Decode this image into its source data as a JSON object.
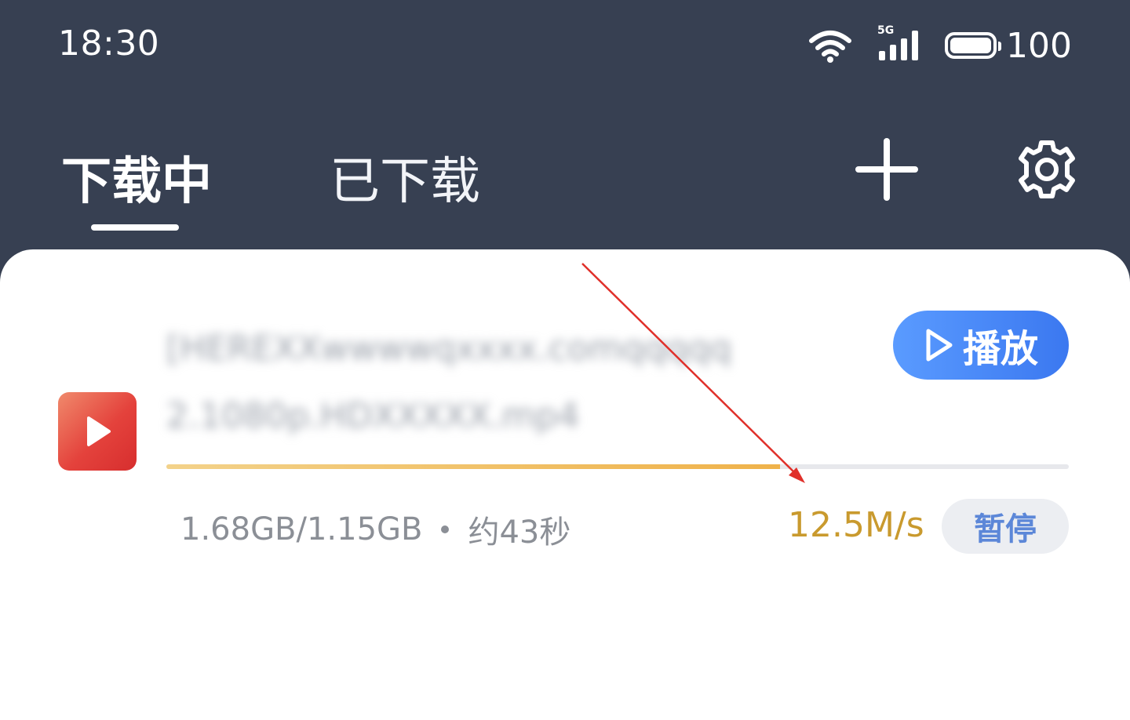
{
  "status_bar": {
    "time": "18:30",
    "network_label": "5G",
    "battery_level": "100",
    "battery_fill_fraction": 1.0
  },
  "tabs": [
    {
      "label": "下载中",
      "active": true
    },
    {
      "label": "已下载",
      "active": false
    }
  ],
  "header": {
    "add_icon": "plus-icon",
    "settings_icon": "gear-icon"
  },
  "download_item": {
    "file_icon": "video-play-icon",
    "file_name_line1": "[HEREXXwwwwqxxxx.comqqqqq",
    "file_name_line2": "2.1080p.HDXXXXX.mp4",
    "play_label": "播放",
    "progress_fraction": 0.68,
    "size_text": "1.68GB/1.15GB",
    "eta_text": "约43秒",
    "speed_text": "12.5M/s",
    "pause_label": "暂停"
  },
  "colors": {
    "header_bg": "#374052",
    "play_button": "#3b78f0",
    "speed_text": "#c99a2e",
    "progress": "#efb24a",
    "annotation_arrow": "#e0302a"
  }
}
